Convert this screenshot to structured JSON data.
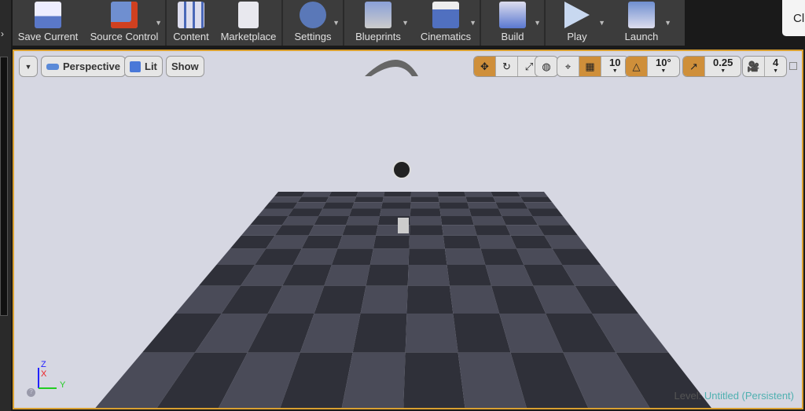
{
  "toolbar": {
    "items": [
      {
        "label": "Save Current",
        "icon": "save-icon"
      },
      {
        "label": "Source Control",
        "icon": "source-control-icon"
      },
      {
        "label": "Content",
        "icon": "content-icon"
      },
      {
        "label": "Marketplace",
        "icon": "marketplace-icon"
      },
      {
        "label": "Settings",
        "icon": "settings-icon"
      },
      {
        "label": "Blueprints",
        "icon": "blueprints-icon"
      },
      {
        "label": "Cinematics",
        "icon": "cinematics-icon"
      },
      {
        "label": "Build",
        "icon": "build-icon"
      },
      {
        "label": "Play",
        "icon": "play-icon"
      },
      {
        "label": "Launch",
        "icon": "launch-icon"
      }
    ]
  },
  "popup": {
    "text": "Cl"
  },
  "viewport": {
    "view_mode": "Perspective",
    "lighting": "Lit",
    "show": "Show",
    "grid_snap": "10",
    "rotation_snap": "10°",
    "scale_snap": "0.25",
    "camera_speed": "4",
    "axes": {
      "z": "Z",
      "x": "X",
      "y": "Y"
    },
    "level_label": "Level:",
    "level_name": "Untitled (Persistent)"
  },
  "colors": {
    "accent": "#cf8f3a",
    "border": "#d9a030"
  }
}
